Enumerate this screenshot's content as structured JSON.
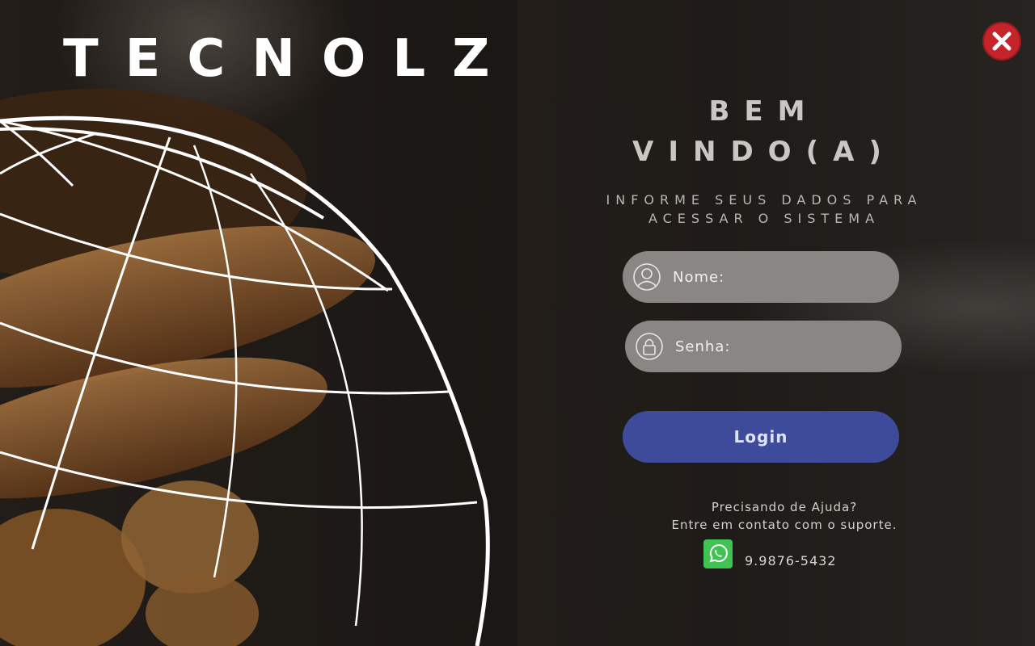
{
  "brand": {
    "name": "TECNOLZ"
  },
  "header": {
    "close_icon": "close-icon"
  },
  "welcome": {
    "line1": "BEM",
    "line2": "VINDO(A)",
    "subtitle_line1": "INFORME SEUS DADOS PARA",
    "subtitle_line2": "ACESSAR O SISTEMA"
  },
  "form": {
    "name_placeholder": "Nome:",
    "name_icon": "user-icon",
    "password_placeholder": "Senha:",
    "password_icon": "lock-icon",
    "login_label": "Login"
  },
  "help": {
    "line1": "Precisando de Ajuda?",
    "line2": "Entre em contato com o suporte.",
    "whatsapp_icon": "whatsapp-icon",
    "phone": "9.9876-5432"
  },
  "colors": {
    "close": "#c4242a",
    "login_button": "#3d4b9a",
    "whatsapp": "#3fc453",
    "field": "#8a8683"
  }
}
